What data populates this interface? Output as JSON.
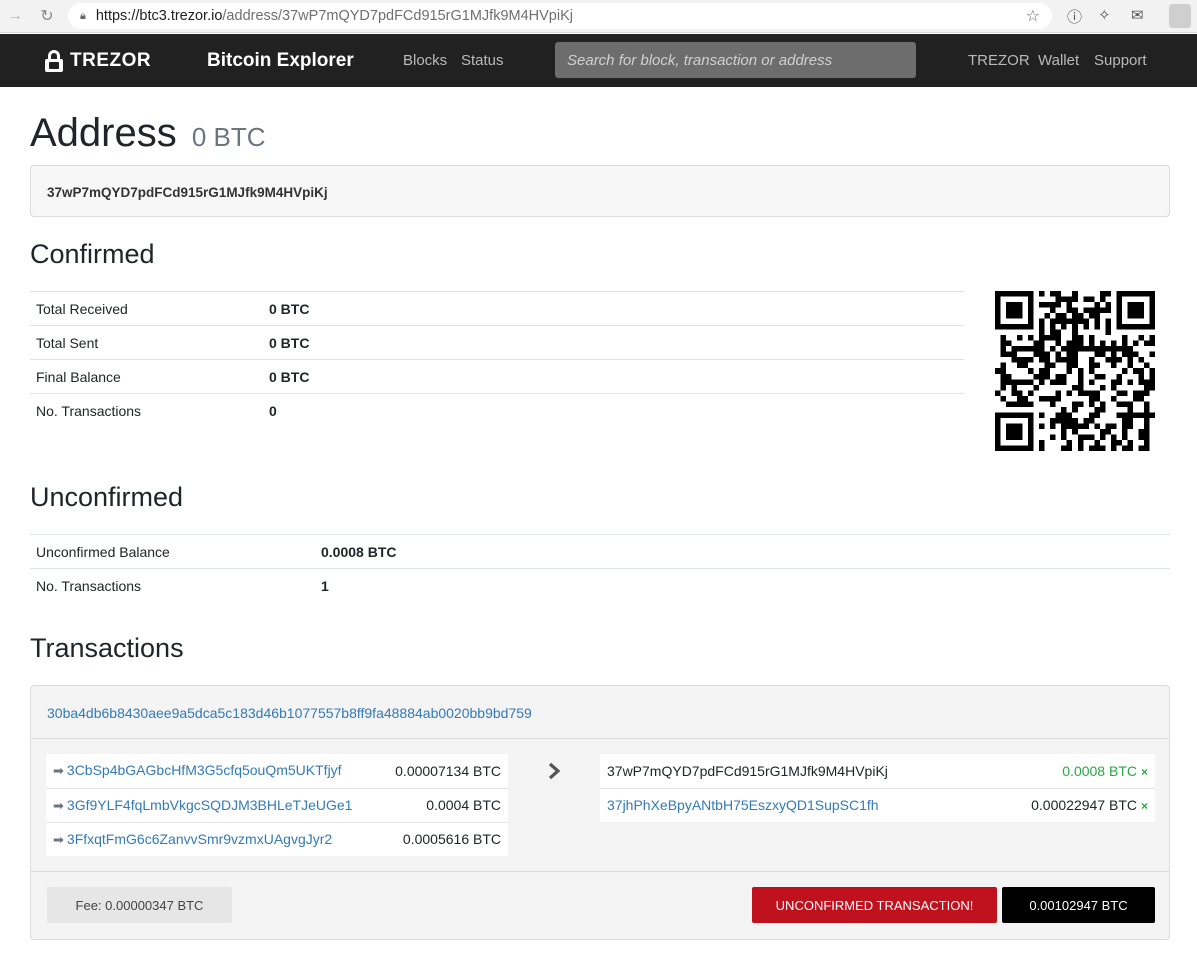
{
  "browser": {
    "url_host": "https://btc3.trezor.io",
    "url_path": "/address/37wP7mQYD7pdFCd915rG1MJfk9M4HVpiKj"
  },
  "navbar": {
    "brand": "TREZOR",
    "site_title": "Bitcoin Explorer",
    "links": [
      "Blocks",
      "Status"
    ],
    "search_placeholder": "Search for block, transaction or address",
    "right_links": [
      "TREZOR",
      "Wallet",
      "Support"
    ]
  },
  "page": {
    "title": "Address",
    "balance": "0 BTC",
    "address": "37wP7mQYD7pdFCd915rG1MJfk9M4HVpiKj"
  },
  "confirmed": {
    "heading": "Confirmed",
    "rows": [
      {
        "label": "Total Received",
        "value": "0 BTC"
      },
      {
        "label": "Total Sent",
        "value": "0 BTC"
      },
      {
        "label": "Final Balance",
        "value": "0 BTC"
      },
      {
        "label": "No. Transactions",
        "value": "0"
      }
    ]
  },
  "unconfirmed": {
    "heading": "Unconfirmed",
    "rows": [
      {
        "label": "Unconfirmed Balance",
        "value": "0.0008 BTC"
      },
      {
        "label": "No. Transactions",
        "value": "1"
      }
    ]
  },
  "transactions": {
    "heading": "Transactions",
    "items": [
      {
        "txid": "30ba4db6b8430aee9a5dca5c183d46b1077557b8ff9fa48884ab0020bb9bd759",
        "inputs": [
          {
            "address": "3CbSp4bGAGbcHfM3G5cfq5ouQm5UKTfjyf",
            "amount": "0.00007134 BTC"
          },
          {
            "address": "3Gf9YLF4fqLmbVkgcSQDJM3BHLeTJeUGe1",
            "amount": "0.0004 BTC"
          },
          {
            "address": "3FfxqtFmG6c6ZanvvSmr9vzmxUAgvgJyr2",
            "amount": "0.0005616 BTC"
          }
        ],
        "outputs": [
          {
            "address": "37wP7mQYD7pdFCd915rG1MJfk9M4HVpiKj",
            "amount": "0.0008 BTC",
            "own": true,
            "spent_mark": "×"
          },
          {
            "address": "37jhPhXeBpyANtbH75EszxyQD1SupSC1fh",
            "amount": "0.00022947 BTC",
            "own": false,
            "spent_mark": "×"
          }
        ],
        "fee": "Fee: 0.00000347 BTC",
        "status": "UNCONFIRMED TRANSACTION!",
        "total": "0.00102947 BTC"
      }
    ]
  },
  "colors": {
    "navbar": "#212121",
    "link": "#337ab7",
    "own_amount": "#28a745",
    "unconfirmed_badge": "#c0111e"
  }
}
